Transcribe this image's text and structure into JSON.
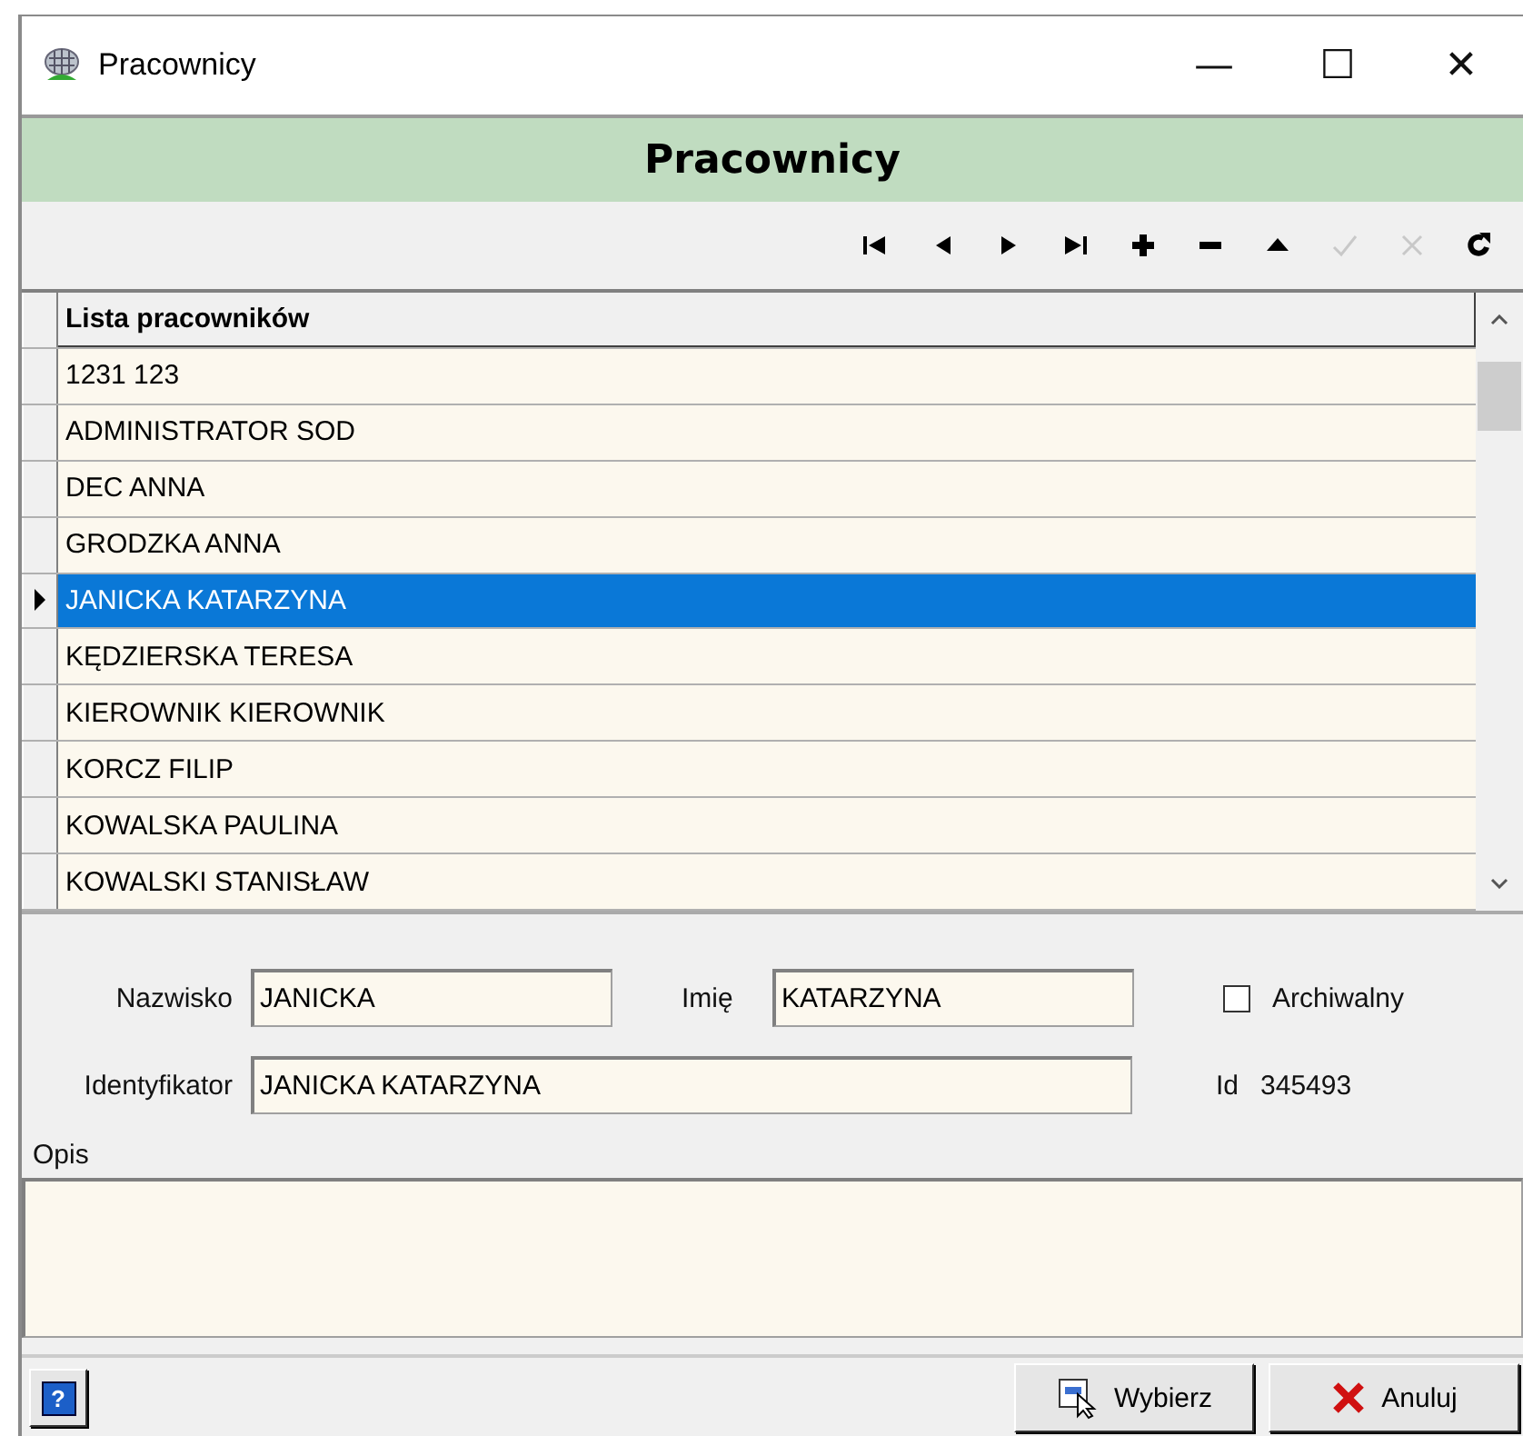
{
  "window": {
    "title": "Pracownicy",
    "controls": [
      "—",
      "☐",
      "✕"
    ]
  },
  "header": {
    "title": "Pracownicy"
  },
  "toolbar": [
    {
      "kind": "first",
      "disabled": false
    },
    {
      "kind": "prior",
      "disabled": false
    },
    {
      "kind": "next",
      "disabled": false
    },
    {
      "kind": "last",
      "disabled": false
    },
    {
      "kind": "insert",
      "disabled": false
    },
    {
      "kind": "delete",
      "disabled": false
    },
    {
      "kind": "edit",
      "disabled": false
    },
    {
      "kind": "post",
      "disabled": true
    },
    {
      "kind": "cancel",
      "disabled": true
    },
    {
      "kind": "refresh",
      "disabled": false
    }
  ],
  "table": {
    "columns": [
      "Lista pracowników"
    ],
    "rows": [
      {
        "name": "1231 123",
        "selected": false
      },
      {
        "name": "ADMINISTRATOR SOD",
        "selected": false
      },
      {
        "name": "DEC ANNA",
        "selected": false
      },
      {
        "name": "GRODZKA ANNA",
        "selected": false
      },
      {
        "name": "JANICKA KATARZYNA",
        "selected": true
      },
      {
        "name": "KĘDZIERSKA TERESA",
        "selected": false
      },
      {
        "name": "KIEROWNIK KIEROWNIK",
        "selected": false
      },
      {
        "name": "KORCZ FILIP",
        "selected": false
      },
      {
        "name": "KOWALSKA PAULINA",
        "selected": false
      },
      {
        "name": "KOWALSKI STANISŁAW",
        "selected": false
      }
    ]
  },
  "form": {
    "surname_label": "Nazwisko",
    "surname": "JANICKA",
    "first_name_label": "Imię",
    "first_name": "KATARZYNA",
    "archive_label": "Archiwalny",
    "archived": false,
    "identifier_label": "Identyfikator",
    "identifier": "JANICKA KATARZYNA",
    "id_label": "Id",
    "id": "345493",
    "description_label": "Opis"
  },
  "buttons": {
    "help": "?",
    "select": "Wybierz",
    "cancel": "Anuluj"
  }
}
